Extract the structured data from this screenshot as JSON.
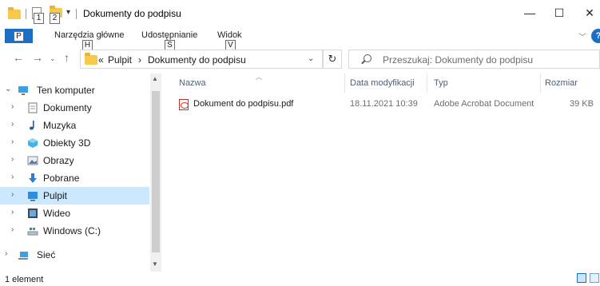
{
  "window": {
    "title": "Dokumenty do podpisu",
    "minimize": "—",
    "maximize": "☐",
    "close": "✕"
  },
  "quick_access": {
    "keytip_1": "1",
    "keytip_2": "2"
  },
  "ribbon": {
    "file_keytip": "P",
    "tabs": [
      {
        "label": "Narzędzia główne",
        "keytip": "H"
      },
      {
        "label": "Udostępnianie",
        "keytip": "S"
      },
      {
        "label": "Widok",
        "keytip": "V"
      }
    ],
    "help": "?"
  },
  "address": {
    "overflow": "«",
    "crumbs": [
      "Pulpit",
      "Dokumenty do podpisu"
    ],
    "separator": "›"
  },
  "search": {
    "placeholder": "Przeszukaj: Dokumenty do podpisu"
  },
  "navigation": [
    {
      "label": "Ten komputer",
      "icon": "computer-icon",
      "expanded": true
    },
    {
      "label": "Dokumenty",
      "icon": "documents-icon"
    },
    {
      "label": "Muzyka",
      "icon": "music-icon"
    },
    {
      "label": "Obiekty 3D",
      "icon": "objects3d-icon"
    },
    {
      "label": "Obrazy",
      "icon": "pictures-icon"
    },
    {
      "label": "Pobrane",
      "icon": "downloads-icon"
    },
    {
      "label": "Pulpit",
      "icon": "desktop-icon",
      "selected": true
    },
    {
      "label": "Wideo",
      "icon": "video-icon"
    },
    {
      "label": "Windows (C:)",
      "icon": "drive-icon"
    },
    {
      "label": "Sieć",
      "icon": "network-icon"
    }
  ],
  "columns": {
    "name": "Nazwa",
    "modified": "Data modyfikacji",
    "type": "Typ",
    "size": "Rozmiar"
  },
  "files": [
    {
      "name": "Dokument do podpisu.pdf",
      "modified": "18.11.2021 10:39",
      "type": "Adobe Acrobat Document",
      "size": "39 KB",
      "icon": "pdf-icon"
    }
  ],
  "status": {
    "count": "1 element"
  },
  "colors": {
    "accent": "#1a6fc4",
    "selection": "#cce8ff",
    "folder": "#f6c94b",
    "column_header": "#4c607a"
  }
}
